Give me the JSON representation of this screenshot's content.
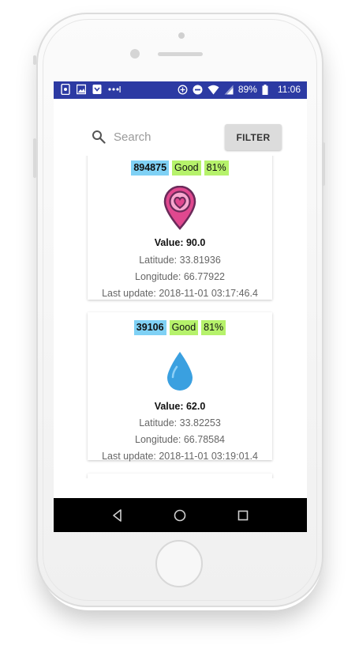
{
  "status_bar": {
    "battery_percent": "89%",
    "time": "11:06",
    "left_icons": [
      "screen-record-icon",
      "image-icon",
      "download-icon",
      "more-notifications-icon"
    ],
    "right_icons": [
      "data-saver-icon",
      "do-not-disturb-icon",
      "wifi-icon",
      "signal-icon",
      "battery-icon"
    ]
  },
  "search": {
    "placeholder": "Search",
    "value": ""
  },
  "filter_button": {
    "label": "FILTER"
  },
  "cards": [
    {
      "id": "894875",
      "status": "Good",
      "percent": "81%",
      "icon": "heart-location-pin-icon",
      "value": "Value: 90.0",
      "latitude": "Latitude: 33.81936",
      "longitude": "Longitude: 66.77922",
      "last_update": "Last update: 2018-11-01 03:17:46.4"
    },
    {
      "id": "39106",
      "status": "Good",
      "percent": "81%",
      "icon": "water-drop-icon",
      "value": "Value: 62.0",
      "latitude": "Latitude: 33.82253",
      "longitude": "Longitude: 66.78584",
      "last_update": "Last update: 2018-11-01 03:19:01.4"
    }
  ],
  "nav_bar": {
    "icons": [
      "back-icon",
      "home-icon",
      "recents-icon"
    ]
  },
  "colors": {
    "status_bar": "#2c3aa3",
    "id_badge": "#7fd1f5",
    "status_badge": "#b6f26b",
    "filter_button": "#dcdcdc",
    "pin_fill": "#e0488f",
    "drop_fill": "#3aa0e0"
  }
}
